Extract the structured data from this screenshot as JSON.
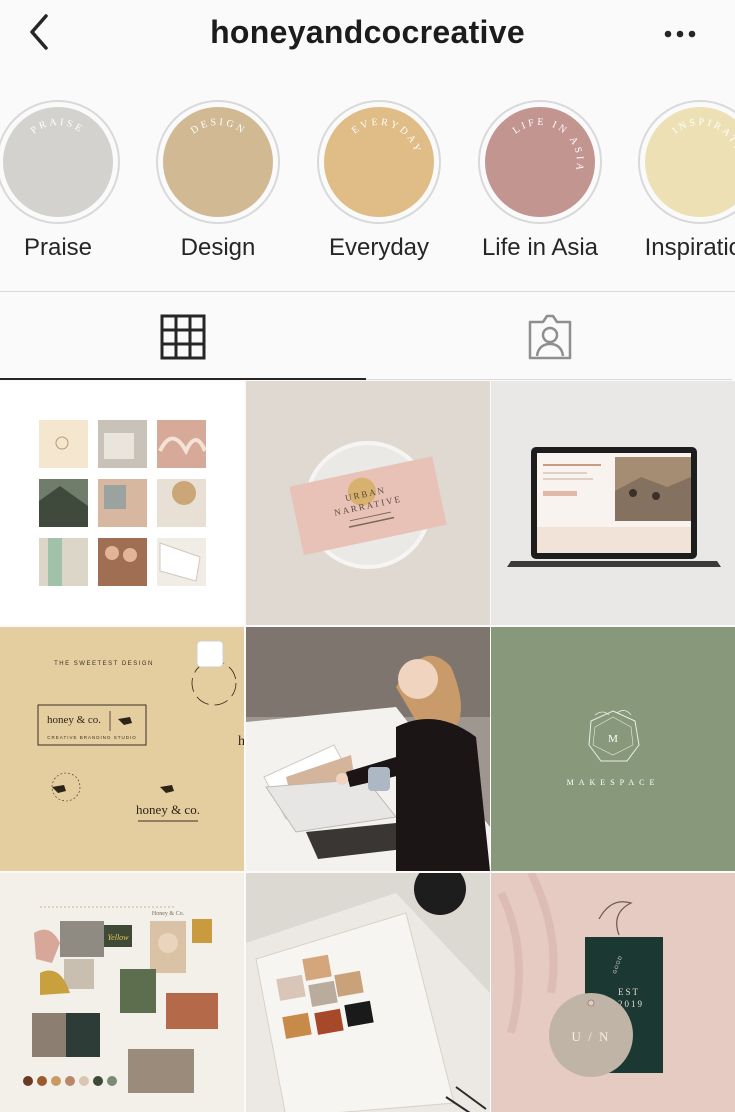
{
  "header": {
    "username": "honeyandcocreative"
  },
  "highlights": [
    {
      "label": "Praise",
      "cover_text": "PRAISE",
      "color": "#d3d2ce"
    },
    {
      "label": "Design",
      "cover_text": "DESIGN",
      "color": "#d1b994"
    },
    {
      "label": "Everyday",
      "cover_text": "EVERYDAY",
      "color": "#e0bc87"
    },
    {
      "label": "Life in Asia",
      "cover_text": "LIFE IN ASIA",
      "color": "#c39591"
    },
    {
      "label": "Inspiration",
      "cover_text": "INSPIRATION",
      "color": "#ece0b4"
    }
  ],
  "tabs": [
    {
      "name": "grid",
      "icon": "grid-icon",
      "selected": true
    },
    {
      "name": "tagged",
      "icon": "tagged-person-icon",
      "selected": false
    }
  ],
  "posts": {
    "p2": {
      "line1": "URBAN",
      "line2": "NARRATIVE"
    },
    "p4": {
      "top_text": "THE SWEETEST DESIGN",
      "logo": "honey & co.",
      "tagline": "CREATIVE BRANDING STUDIO",
      "logo2": "honey & co.",
      "edge_text": "h"
    },
    "p6": {
      "monogram": "M",
      "wordmark": "MAKESPACE"
    },
    "p7": {
      "header_text": "Honey & Co.",
      "sign_text": "Yellow"
    },
    "p9": {
      "tag_text1": "EST",
      "tag_text2": "2019",
      "tag_small": "GOOD",
      "monogram": "U / N"
    }
  },
  "colors": {
    "tab_active": "#262626",
    "divider": "#dbdbdb",
    "background": "#fafafa"
  }
}
